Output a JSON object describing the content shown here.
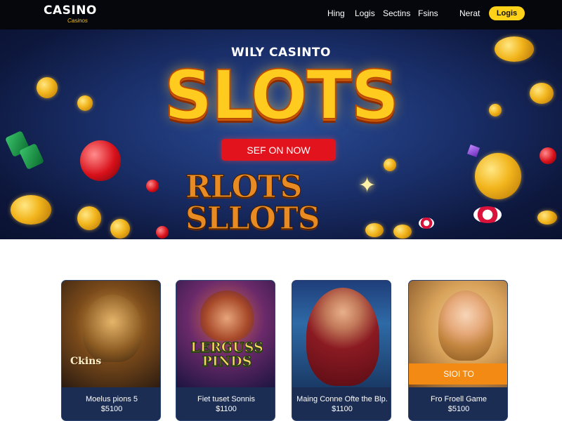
{
  "header": {
    "logo_main": "CASINO",
    "logo_sub": "Casinos",
    "nav": [
      "Hing",
      "Logis",
      "Sectins",
      "Fsins",
      "Nerat"
    ],
    "login_label": "Logis"
  },
  "hero": {
    "kicker": "WILY CASINTO",
    "title": "SLOTS",
    "cta_label": "SEF ON NOW",
    "logo_line1": "RLOTS",
    "logo_line2": "SLLOTS"
  },
  "cards": [
    {
      "art_text": "Ckins",
      "name": "Moelus pions 5",
      "price": "$5100"
    },
    {
      "art_text": "LERGUSS PINDS",
      "name": "Fiet tuset Sonnis",
      "price": "$1100"
    },
    {
      "art_text": "",
      "name": "Maing Conne Ofte the Blp.",
      "price": "$1100"
    },
    {
      "art_text": "",
      "name": "Fro Froell Game",
      "price": "$5100",
      "badge": "SIOI TO"
    }
  ],
  "colors": {
    "header_bg": "#06070c",
    "accent_yellow": "#ffd21a",
    "cta_red": "#e3131d",
    "hero_blue": "#1a2f6a",
    "card_bg": "#1b2d52",
    "badge_orange": "#f28a14"
  }
}
